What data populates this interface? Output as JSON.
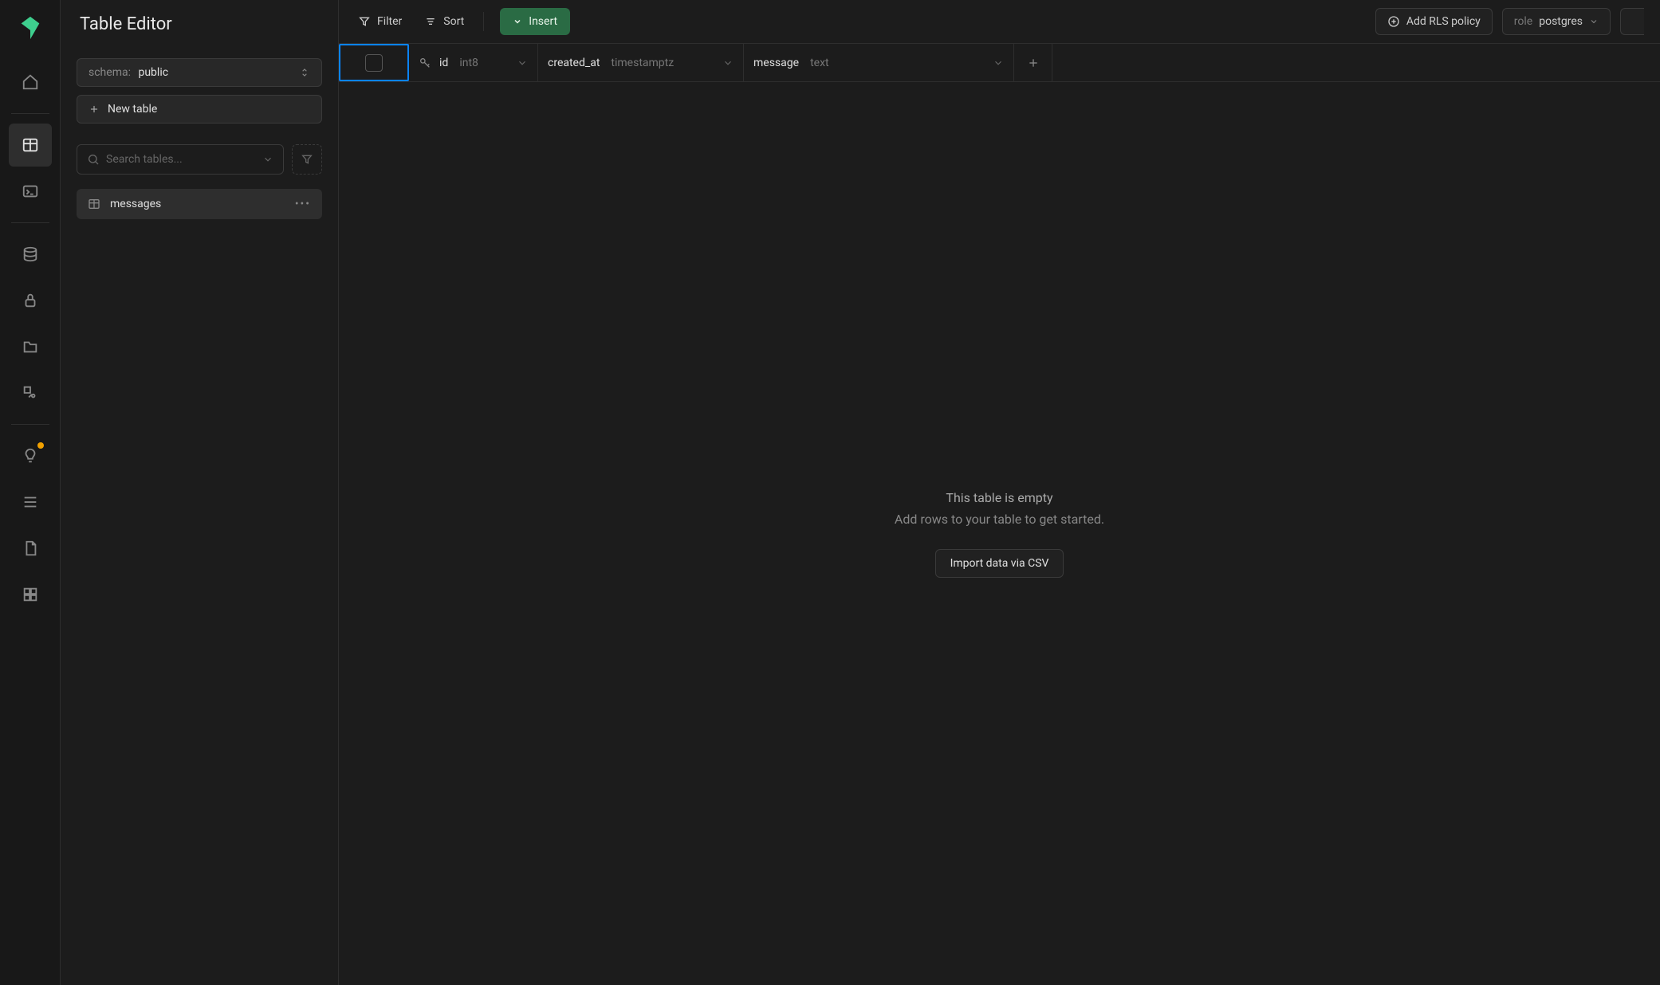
{
  "header": {
    "title": "Table Editor"
  },
  "sidebar": {
    "schema_label": "schema:",
    "schema_name": "public",
    "new_table_label": "New table",
    "search_placeholder": "Search tables...",
    "tables": [
      {
        "name": "messages"
      }
    ]
  },
  "toolbar": {
    "filter_label": "Filter",
    "sort_label": "Sort",
    "insert_label": "Insert",
    "rls_label": "Add RLS policy",
    "role_label": "role",
    "role_name": "postgres"
  },
  "columns": [
    {
      "name": "id",
      "type": "int8",
      "is_pk": true
    },
    {
      "name": "created_at",
      "type": "timestamptz",
      "is_pk": false
    },
    {
      "name": "message",
      "type": "text",
      "is_pk": false
    }
  ],
  "empty_state": {
    "title": "This table is empty",
    "subtitle": "Add rows to your table to get started.",
    "import_label": "Import data via CSV"
  }
}
